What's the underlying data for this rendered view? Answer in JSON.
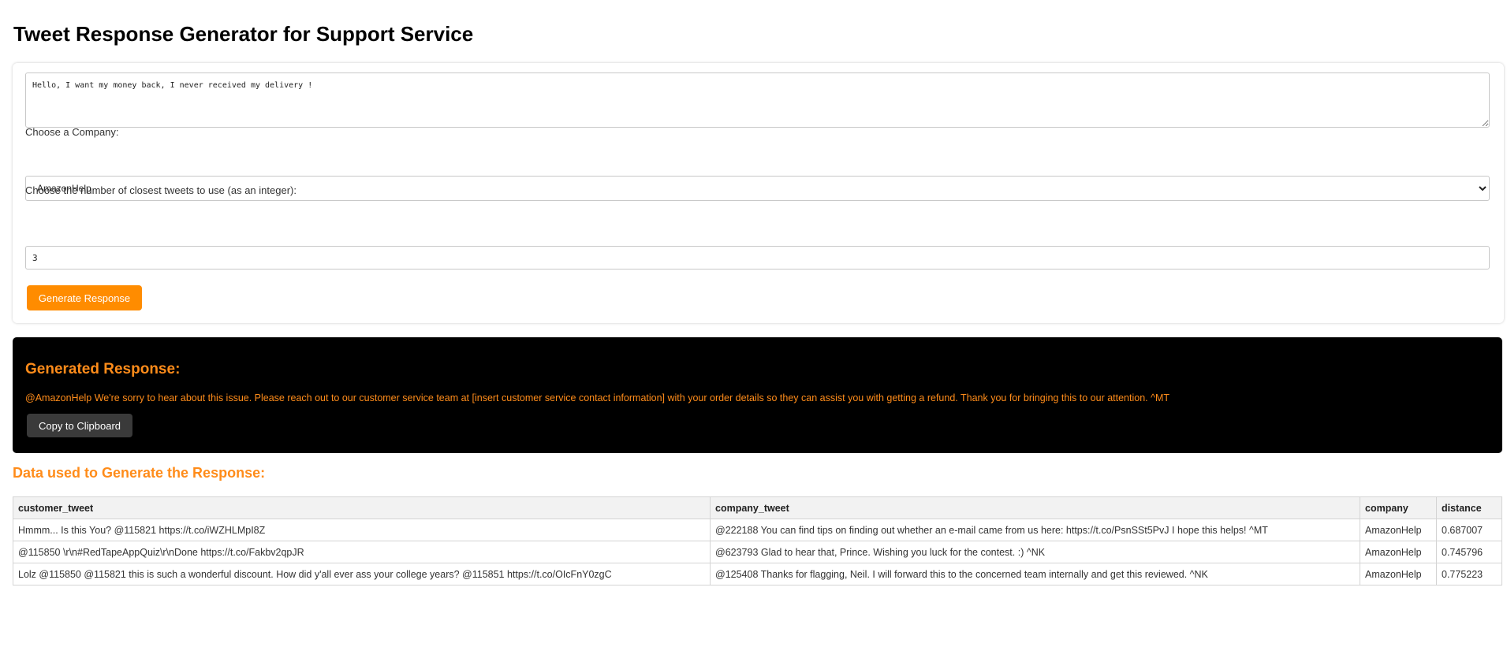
{
  "page": {
    "title": "Tweet Response Generator for Support Service"
  },
  "form": {
    "tweet_value": "Hello, I want my money back, I never received my delivery !",
    "company_label": "Choose a Company:",
    "company_selected": "AmazonHelp",
    "num_label": "Choose the number of closest tweets to use (as an integer):",
    "num_value": "3",
    "generate_label": "Generate Response"
  },
  "response": {
    "heading": "Generated Response:",
    "text": "@AmazonHelp We're sorry to hear about this issue. Please reach out to our customer service team at [insert customer service contact information] with your order details so they can assist you with getting a refund. Thank you for bringing this to our attention. ^MT",
    "copy_label": "Copy to Clipboard"
  },
  "data_section": {
    "heading": "Data used to Generate the Response:",
    "columns": [
      "customer_tweet",
      "company_tweet",
      "company",
      "distance"
    ],
    "rows": [
      [
        "Hmmm... Is this You? @115821 https://t.co/iWZHLMpI8Z",
        "@222188 You can find tips on finding out whether an e-mail came from us here: https://t.co/PsnSSt5PvJ I hope this helps! ^MT",
        "AmazonHelp",
        "0.687007"
      ],
      [
        "@115850 \\r\\n#RedTapeAppQuiz\\r\\nDone https://t.co/Fakbv2qpJR",
        "@623793 Glad to hear that, Prince. Wishing you luck for the contest. :) ^NK",
        "AmazonHelp",
        "0.745796"
      ],
      [
        "Lolz @115850 @115821 this is such a wonderful discount. How did y'all ever ass your college years? @115851 https://t.co/OIcFnY0zgC",
        "@125408 Thanks for flagging, Neil. I will forward this to the concerned team internally and get this reviewed. ^NK",
        "AmazonHelp",
        "0.775223"
      ]
    ]
  },
  "colors": {
    "accent": "#ff8c00",
    "response_bg": "#000000",
    "copy_button_bg": "#3a3a3a"
  }
}
